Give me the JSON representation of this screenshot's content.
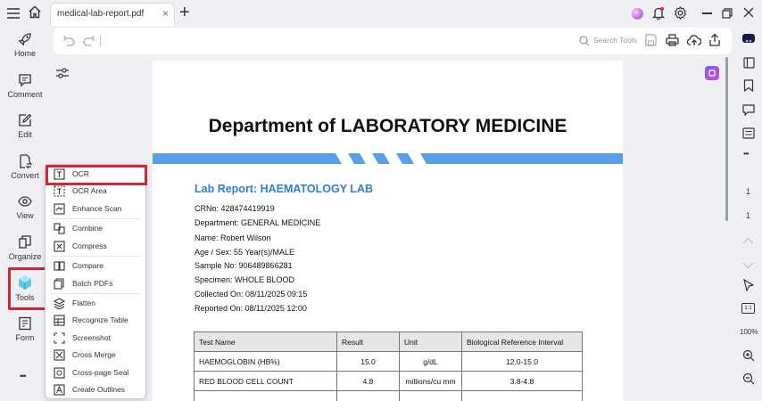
{
  "tab": {
    "label": "medical-lab-report.pdf",
    "close": "×",
    "new": "+"
  },
  "toolbar": {
    "search_label": "Search Tools"
  },
  "nav": {
    "items": [
      {
        "label": "Home"
      },
      {
        "label": "Comment"
      },
      {
        "label": "Edit"
      },
      {
        "label": "Convert"
      },
      {
        "label": "View"
      },
      {
        "label": "Organize"
      },
      {
        "label": "Tools"
      },
      {
        "label": "Form"
      }
    ],
    "more": "•••"
  },
  "tools_menu": {
    "items": [
      {
        "label": "OCR"
      },
      {
        "label": "OCR Area"
      },
      {
        "label": "Enhance Scan"
      },
      {
        "label": "Combine"
      },
      {
        "label": "Compress"
      },
      {
        "label": "Compare"
      },
      {
        "label": "Batch PDFs"
      },
      {
        "label": "Flatten"
      },
      {
        "label": "Recognize Table"
      },
      {
        "label": "Screenshot"
      },
      {
        "label": "Cross Merge"
      },
      {
        "label": "Cross-page Seal"
      },
      {
        "label": "Create Outlines"
      }
    ]
  },
  "rightrail": {
    "page_number": "1",
    "page_total": "1",
    "zoom": "100%",
    "fit": "1:1",
    "more": "•••"
  },
  "document": {
    "title": "Department of LABORATORY MEDICINE",
    "report_title": "Lab Report: HAEMATOLOGY LAB",
    "info_lines": [
      "CRNo: 428474419919",
      "Department: GENERAL MEDICINE",
      "Name: Robert Wilson",
      "Age / Sex: 55 Year(s)/MALE",
      "Sample No: 906489866281",
      "Specimen: WHOLE BLOOD",
      "Collected On: 08/11/2025 09:15",
      "Reported On: 08/11/2025 12:00"
    ],
    "table": {
      "headers": [
        "Test Name",
        "Result",
        "Unit",
        "Biological Reference Interval"
      ],
      "rows": [
        [
          "HAEMOGLOBIN (HB%)",
          "15.0",
          "g/dL",
          "12.0-15.0"
        ],
        [
          "RED BLOOD CELL COUNT",
          "4.8",
          "millions/cu mm",
          "3.8-4.8"
        ]
      ]
    }
  },
  "colors": {
    "accent_blue": "#2f7fd0",
    "highlight_red": "#d32533",
    "band_blue": "#5a9ee8"
  }
}
